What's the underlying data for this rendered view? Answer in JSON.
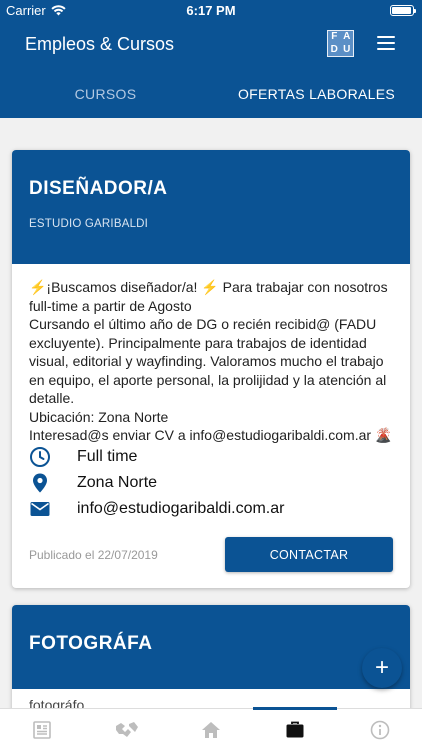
{
  "status_bar": {
    "carrier": "Carrier",
    "time": "6:17 PM",
    "battery_level": 0.95
  },
  "app_bar": {
    "title": "Empleos & Cursos",
    "logo_letters": [
      "F",
      "A",
      "D",
      "U"
    ]
  },
  "tabs": [
    {
      "label": "CURSOS",
      "active": false
    },
    {
      "label": "OFERTAS LABORALES",
      "active": true
    }
  ],
  "job_cards": [
    {
      "title": "DISEÑADOR/A",
      "company": "ESTUDIO GARIBALDI",
      "description": "⚡¡Buscamos diseñador/a! ⚡ Para trabajar con nosotros full-time a partir de Agosto\nCursando el último año de DG o recién recibid@ (FADU excluyente). Principalmente para trabajos de identidad visual, editorial y wayfinding. Valoramos mucho el trabajo en equipo, el aporte personal, la prolijidad y la atención al detalle.\nUbicación: Zona Norte\nInteresad@s enviar CV a info@estudiogaribaldi.com.ar 🌋",
      "schedule": "Full time",
      "location": "Zona Norte",
      "email": "info@estudiogaribaldi.com.ar",
      "published": "Publicado el 22/07/2019",
      "contact_label": "CONTACTAR"
    },
    {
      "title": "FOTOGRÁFA",
      "snippet": "fotográfo     ...     ...     ...    "
    }
  ],
  "fab": {
    "label": "+"
  },
  "bottom_nav": [
    {
      "icon": "news-icon",
      "active": false
    },
    {
      "icon": "handshake-icon",
      "active": false
    },
    {
      "icon": "home-icon",
      "active": false
    },
    {
      "icon": "briefcase-icon",
      "active": true
    },
    {
      "icon": "info-icon",
      "active": false
    }
  ],
  "colors": {
    "primary": "#0b5394",
    "background": "#f1f1f1",
    "nav_inactive": "#bdbdbd"
  }
}
